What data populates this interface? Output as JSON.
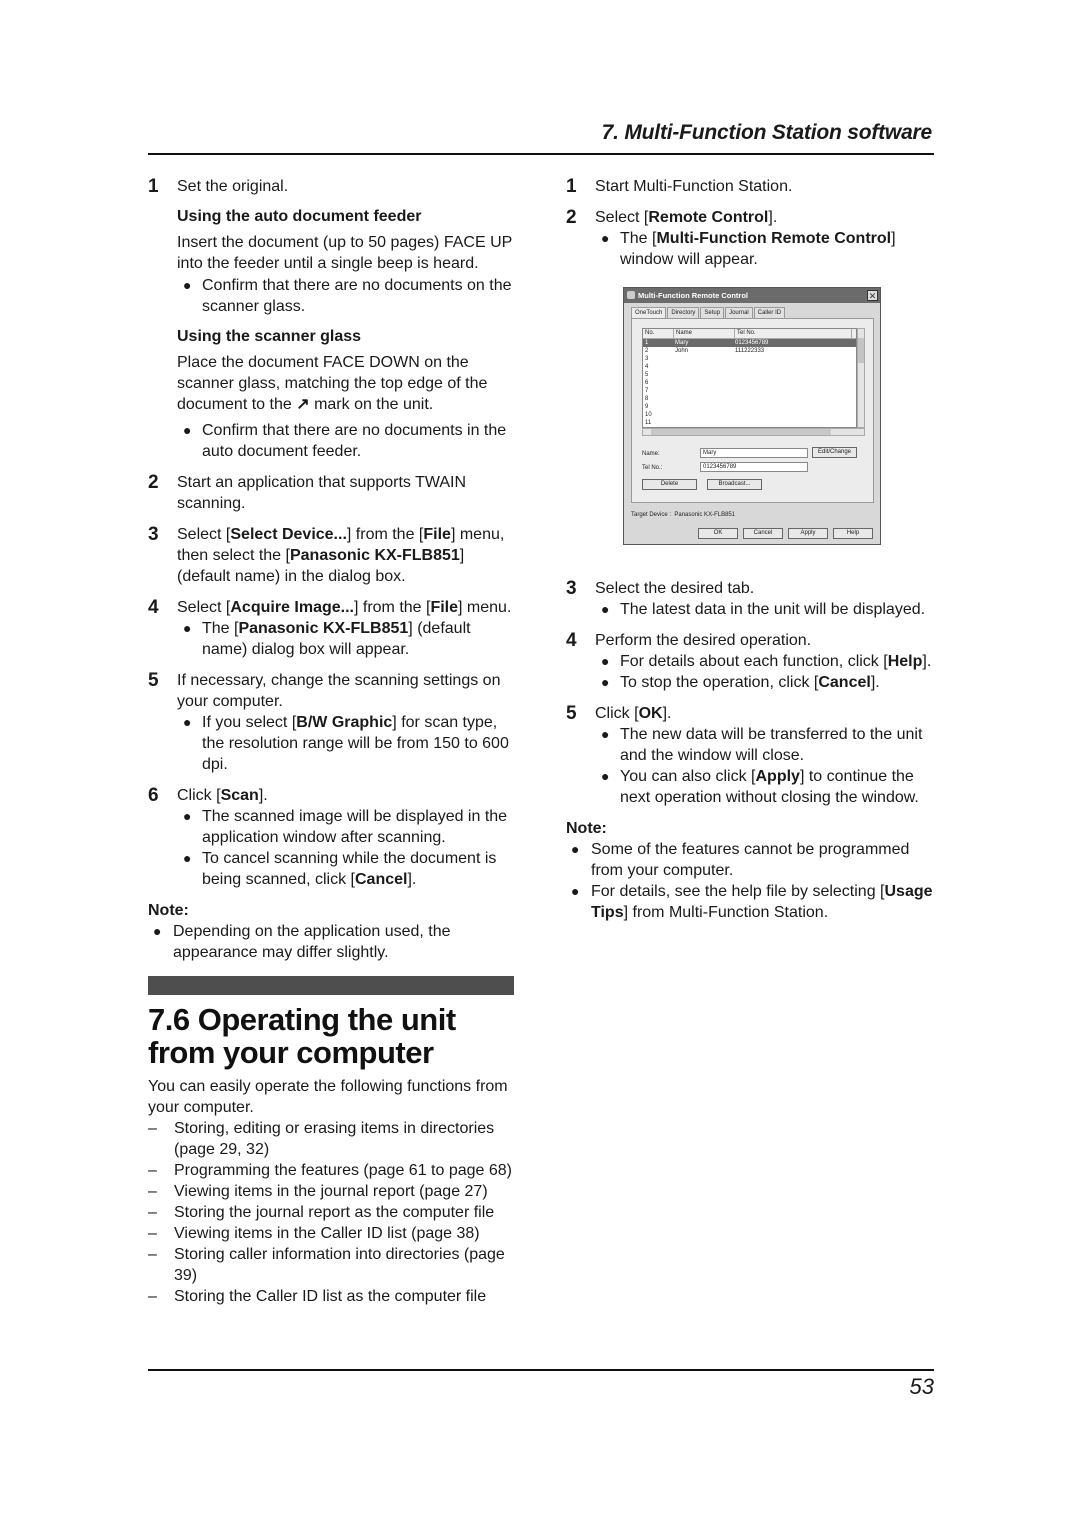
{
  "header": {
    "title": "7. Multi-Function Station software"
  },
  "left": {
    "step1": {
      "num": "1",
      "text": "Set the original.",
      "adf_heading": "Using the auto document feeder",
      "adf_text": "Insert the document (up to 50 pages) FACE UP into the feeder until a single beep is heard.",
      "adf_bullet": "Confirm that there are no documents on the scanner glass.",
      "glass_heading": "Using the scanner glass",
      "glass_text_before": "Place the document FACE DOWN on the scanner glass, matching the top edge of the document to the",
      "glass_arrow": "↗",
      "glass_text_after": "mark on the unit.",
      "glass_bullet": "Confirm that there are no documents in the auto document feeder."
    },
    "step2": {
      "num": "2",
      "text": "Start an application that supports TWAIN scanning."
    },
    "step3": {
      "num": "3",
      "t1": "Select ",
      "b1": "Select Device...",
      "t2": " from the ",
      "b2": "File",
      "t3": " menu, then select the ",
      "b3": "Panasonic KX-FLB851",
      "t4": " (default name) in the dialog box."
    },
    "step4": {
      "num": "4",
      "t1": "Select ",
      "b1": "Acquire Image...",
      "t2": " from the ",
      "b2": "File",
      "t3": " menu.",
      "bullet_t1": "The ",
      "bullet_b1": "Panasonic KX-FLB851",
      "bullet_t2": " (default name) dialog box will appear."
    },
    "step5": {
      "num": "5",
      "text": "If necessary, change the scanning settings on your computer.",
      "bullet_t1": "If you select ",
      "bullet_b1": "B/W Graphic",
      "bullet_t2": " for scan type, the resolution range will be from 150 to 600 dpi."
    },
    "step6": {
      "num": "6",
      "t1": "Click ",
      "b1": "Scan",
      "t2": ".",
      "bullet1": "The scanned image will be displayed in the application window after scanning.",
      "bullet2_t1": "To cancel scanning while the document is being scanned, click ",
      "bullet2_b1": "Cancel",
      "bullet2_t2": "."
    },
    "note": {
      "label": "Note:",
      "bullet": "Depending on the application used, the appearance may differ slightly."
    },
    "section": {
      "title": "7.6 Operating the unit from your computer",
      "intro": "You can easily operate the following functions from your computer.",
      "items": [
        "Storing, editing or erasing items in directories (page 29, 32)",
        "Programming the features (page 61 to page 68)",
        "Viewing items in the journal report (page 27)",
        "Storing the journal report as the computer file",
        "Viewing items in the Caller ID list (page 38)",
        "Storing caller information into directories (page 39)",
        "Storing the Caller ID list as the computer file"
      ],
      "dash": "–"
    }
  },
  "right": {
    "step1": {
      "num": "1",
      "text": "Start Multi-Function Station."
    },
    "step2": {
      "num": "2",
      "t1": "Select ",
      "b1": "Remote Control",
      "t2": ".",
      "bullet_t1": "The ",
      "bullet_b1": "Multi-Function Remote Control",
      "bullet_t2": " window will appear."
    },
    "step3": {
      "num": "3",
      "text": "Select the desired tab.",
      "bullet": "The latest data in the unit will be displayed."
    },
    "step4": {
      "num": "4",
      "text": "Perform the desired operation.",
      "bullet1_t1": "For details about each function, click ",
      "bullet1_b1": "Help",
      "bullet1_t2": ".",
      "bullet2_t1": "To stop the operation, click ",
      "bullet2_b1": "Cancel",
      "bullet2_t2": "."
    },
    "step5": {
      "num": "5",
      "t1": "Click ",
      "b1": "OK",
      "t2": ".",
      "bullet1": "The new data will be transferred to the unit and the window will close.",
      "bullet2_t1": "You can also click ",
      "bullet2_b1": "Apply",
      "bullet2_t2": " to continue the next operation without closing the window."
    },
    "note": {
      "label": "Note:",
      "bullet1": "Some of the features cannot be programmed from your computer.",
      "bullet2_t1": "For details, see the help file by selecting ",
      "bullet2_b1": "Usage Tips",
      "bullet2_t2": " from Multi-Function Station."
    }
  },
  "dialog": {
    "title": "Multi-Function Remote Control",
    "close": "✕",
    "tabs": [
      "OneTouch",
      "Directory",
      "Setup",
      "Journal",
      "Caller ID"
    ],
    "columns": [
      "No.",
      "Name",
      "Tel No."
    ],
    "rows": [
      {
        "no": "1",
        "name": "Mary",
        "tel": "0123456789"
      },
      {
        "no": "2",
        "name": "John",
        "tel": "111222333"
      },
      {
        "no": "3",
        "name": "",
        "tel": ""
      },
      {
        "no": "4",
        "name": "",
        "tel": ""
      },
      {
        "no": "5",
        "name": "",
        "tel": ""
      },
      {
        "no": "6",
        "name": "",
        "tel": ""
      },
      {
        "no": "7",
        "name": "",
        "tel": ""
      },
      {
        "no": "8",
        "name": "",
        "tel": ""
      },
      {
        "no": "9",
        "name": "",
        "tel": ""
      },
      {
        "no": "10",
        "name": "",
        "tel": ""
      },
      {
        "no": "11",
        "name": "",
        "tel": ""
      }
    ],
    "name_label": "Name:",
    "name_value": "Mary",
    "tel_label": "Tel No.:",
    "tel_value": "0123456789",
    "edit_button": "Edit/Change",
    "delete_button": "Delete",
    "broadcast_button": "Broadcast...",
    "target_label": "Target Device :",
    "target_value": "Panasonic KX-FLB851",
    "ok_button": "OK",
    "cancel_button": "Cancel",
    "apply_button": "Apply",
    "help_button": "Help"
  },
  "footer": {
    "page_number": "53"
  },
  "bullet_glyph": "●",
  "lb": "[",
  "rb": "]"
}
